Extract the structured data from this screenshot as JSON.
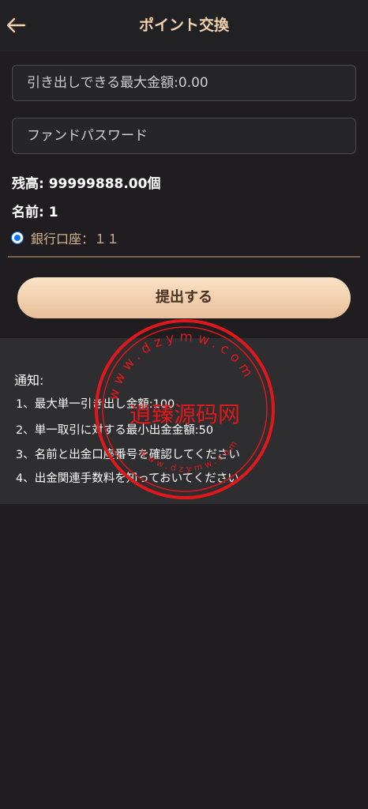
{
  "header": {
    "title": "ポイント交換",
    "back_icon": "arrow-left-icon"
  },
  "form": {
    "max_amount_placeholder": "引き出しできる最大金額:0.00",
    "fund_password_placeholder": "ファンドパスワード"
  },
  "info": {
    "balance": "残高: 99999888.00個",
    "name": "名前: 1",
    "bank_account": "銀行口座：１１"
  },
  "submit": {
    "label": "提出する"
  },
  "notice": {
    "title": "通知:",
    "items": [
      "1、最大単一引き出し金額:100",
      "2、単一取引に対する最小出金金額:50",
      "3、名前と出金口座番号を確認してください",
      "4、出金関連手数料を知っておいてください"
    ]
  },
  "watermark": {
    "text": "逍臻源码网",
    "outer_text": "www.dzymw.com",
    "color": "#e0181b"
  },
  "colors": {
    "accent": "#f3d2b0",
    "button_gradient_top": "#fbe2c6",
    "button_gradient_bottom": "#e8c09a",
    "background": "#1f1d20",
    "radio": "#0b73ff"
  }
}
